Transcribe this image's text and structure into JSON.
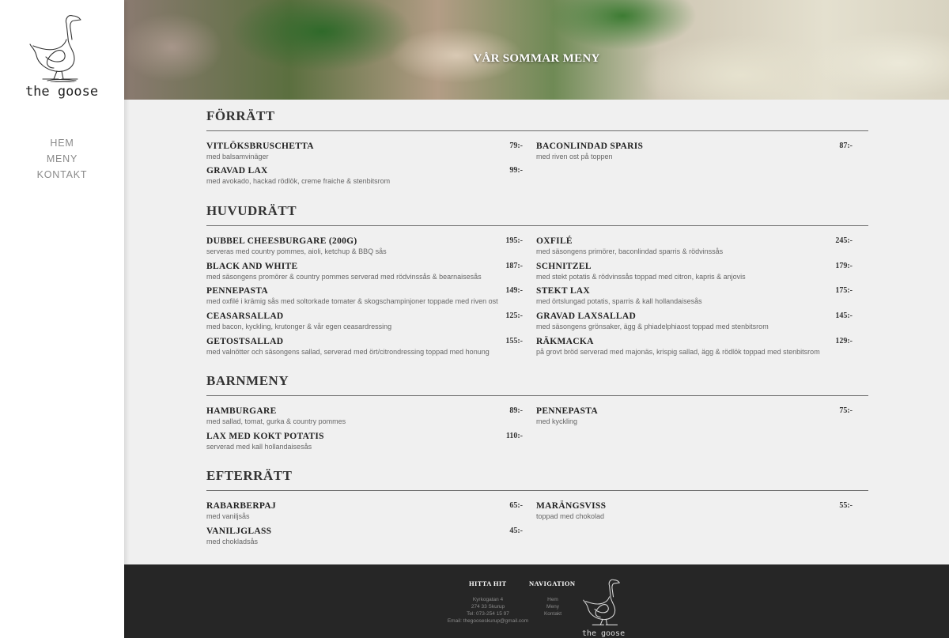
{
  "brand": {
    "name": "the goose"
  },
  "nav": {
    "items": [
      "HEM",
      "MENY",
      "KONTAKT"
    ]
  },
  "hero": {
    "title": "VÅR SOMMAR MENY"
  },
  "sections": [
    {
      "title": "FÖRRÄTT",
      "items": [
        {
          "name": "VITLÖKSBRUSCHETTA",
          "desc": "med balsamvinäger",
          "price": "79:-"
        },
        {
          "name": "BACONLINDAD SPARIS",
          "desc": "med riven ost på toppen",
          "price": "87:-"
        },
        {
          "name": "GRAVAD LAX",
          "desc": "med avokado, hackad rödlök, creme fraiche & stenbitsrom",
          "price": "99:-"
        }
      ]
    },
    {
      "title": "HUVUDRÄTT",
      "items": [
        {
          "name": "DUBBEL CHEESBURGARE (200G)",
          "desc": "serveras med country pommes, aioli, ketchup & BBQ sås",
          "price": "195:-"
        },
        {
          "name": "OXFILÉ",
          "desc": "med säsongens primörer, baconlindad sparris & rödvinssås",
          "price": "245:-"
        },
        {
          "name": "BLACK AND WHITE",
          "desc": "med säsongens promörer & country pommes serverad med rödvinssås & bearnaisesås",
          "price": "187:-"
        },
        {
          "name": "SCHNITZEL",
          "desc": "med stekt potatis & rödvinssås toppad med citron, kapris & anjovis",
          "price": "179:-"
        },
        {
          "name": "PENNEPASTA",
          "desc": "med oxfilé i krämig sås med soltorkade tomater & skogschampinjoner toppade med riven ost",
          "price": "149:-"
        },
        {
          "name": "STEKT LAX",
          "desc": "med örtslungad potatis, sparris & kall hollandaisesås",
          "price": "175:-"
        },
        {
          "name": "CEASARSALLAD",
          "desc": "med bacon, kyckling, krutonger & vår egen ceasardressing",
          "price": "125:-"
        },
        {
          "name": "GRAVAD LAXSALLAD",
          "desc": "med säsongens grönsaker, ägg & phiadelphiaost toppad med stenbitsrom",
          "price": "145:-"
        },
        {
          "name": "GETOSTSALLAD",
          "desc": "med valnötter och säsongens sallad, serverad med ört/citrondressing toppad med honung",
          "price": "155:-"
        },
        {
          "name": "RÄKMACKA",
          "desc": "på grovt bröd serverad med majonäs, krispig sallad, ägg & rödlök toppad med stenbitsrom",
          "price": "129:-"
        }
      ]
    },
    {
      "title": "BARNMENY",
      "items": [
        {
          "name": "HAMBURGARE",
          "desc": "med sallad, tomat, gurka & country pommes",
          "price": "89:-"
        },
        {
          "name": "PENNEPASTA",
          "desc": "med kyckling",
          "price": "75:-"
        },
        {
          "name": "LAX MED KOKT POTATIS",
          "desc": "serverad med kall hollandaisesås",
          "price": "110:-"
        }
      ]
    },
    {
      "title": "EFTERRÄTT",
      "items": [
        {
          "name": "RABARBERPAJ",
          "desc": "med vaniljsås",
          "price": "65:-"
        },
        {
          "name": "MARÄNGSVISS",
          "desc": "toppad med chokolad",
          "price": "55:-"
        },
        {
          "name": "VANILJGLASS",
          "desc": "med chokladsås",
          "price": "45:-"
        }
      ]
    }
  ],
  "footer": {
    "find_title": "HITTA HIT",
    "find_lines": [
      "Kyrkogatan 4",
      "274 33 Skurup",
      "Tel: 073-254 15 97",
      "Email: thegooseskurup@gmail.com"
    ],
    "nav_title": "NAVIGATION",
    "nav_links": [
      "Hem",
      "Meny",
      "Kontakt"
    ],
    "logo_text": "the goose"
  }
}
